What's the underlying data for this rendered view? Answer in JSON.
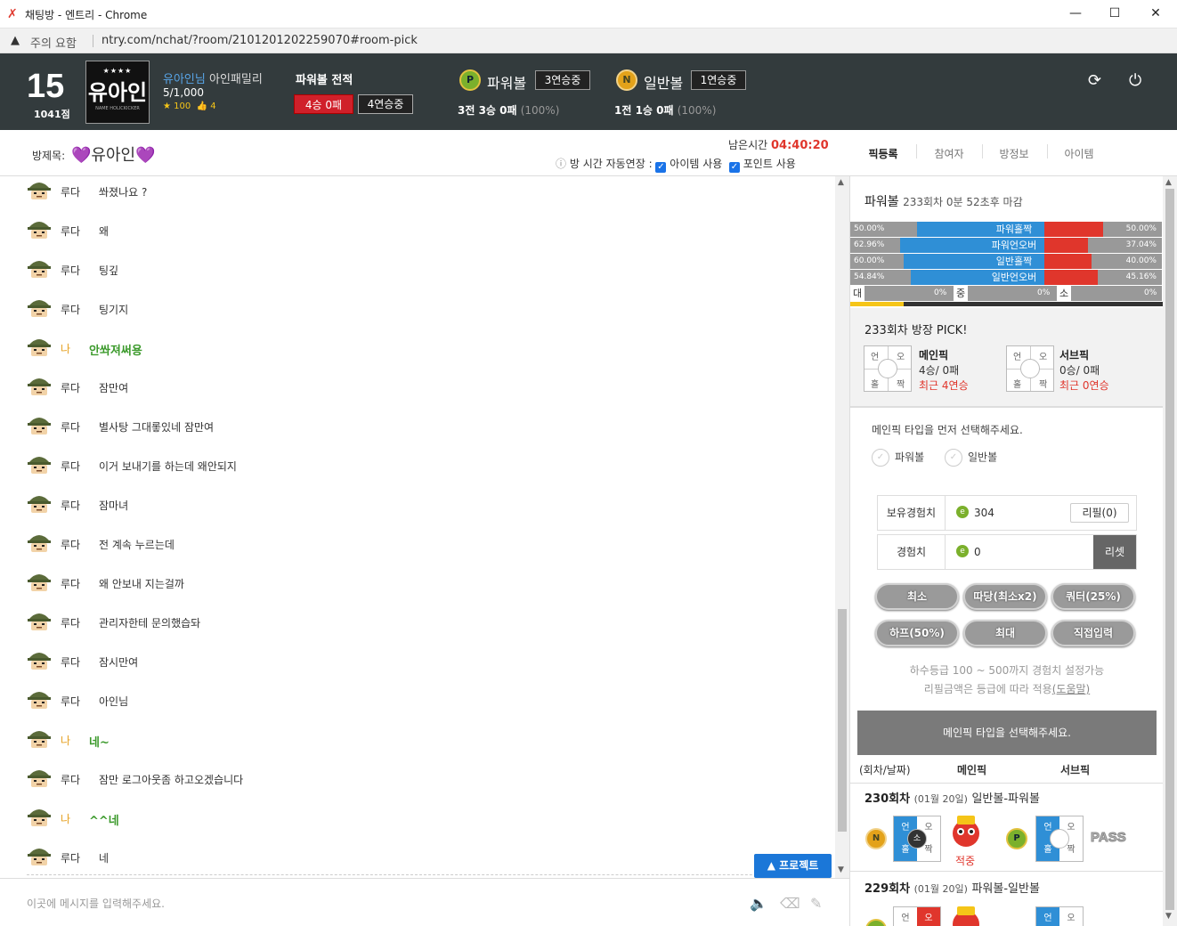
{
  "window": {
    "title": "채팅방 - 엔트리 - Chrome",
    "minimize": "—",
    "maximize": "☐",
    "close": "✕"
  },
  "address": {
    "warning": "주의 요함",
    "url": "ntry.com/nchat/?room/2101201202259070#room-pick"
  },
  "profile": {
    "level": "15",
    "points": "1041점",
    "avatar_stars": "★★★★",
    "avatar_name": "유아인",
    "avatar_sub": "NAME HOLICKICKER",
    "username": "유아인님",
    "family": "아인패밀리",
    "count": "5/1,000",
    "star_count": "100",
    "like_count": "4"
  },
  "record": {
    "title": "파워볼 전적",
    "winloss": "4승 0패",
    "streak": "4연승중"
  },
  "powerball": {
    "icon": "P",
    "label": "파워볼",
    "streak": "3연승중",
    "stat": "3전 3승 0패",
    "pct": "(100%)"
  },
  "normalball": {
    "icon": "N",
    "label": "일반볼",
    "streak": "1연승중",
    "stat": "1전 1승 0패",
    "pct": "(100%)"
  },
  "room": {
    "label": "방제목:",
    "name": "유아인",
    "remain_label": "남은시간",
    "remain_time": "04:40:20",
    "auto_extend": "방 시간 자동연장 :",
    "opt_item": "아이템 사용",
    "opt_point": "포인트 사용"
  },
  "tabs": [
    "픽등록",
    "참여자",
    "방정보",
    "아이템"
  ],
  "messages": [
    {
      "name": "루다",
      "text": "쏴졌나요 ?",
      "me": false
    },
    {
      "name": "루다",
      "text": "왜",
      "me": false
    },
    {
      "name": "루다",
      "text": "팅깊",
      "me": false
    },
    {
      "name": "루다",
      "text": "팅기지",
      "me": false
    },
    {
      "name": "나",
      "text": "안쏴져써용",
      "me": true
    },
    {
      "name": "루다",
      "text": "잠만여",
      "me": false
    },
    {
      "name": "루다",
      "text": "별사탕 그대롷있네 잠만여",
      "me": false
    },
    {
      "name": "루다",
      "text": "이거 보내기를 하는데 왜안되지",
      "me": false
    },
    {
      "name": "루다",
      "text": "잠마녀",
      "me": false
    },
    {
      "name": "루다",
      "text": "전 계속 누르는데",
      "me": false
    },
    {
      "name": "루다",
      "text": "왜 안보내 지는걸까",
      "me": false
    },
    {
      "name": "루다",
      "text": "관리자한테 문의했습돠",
      "me": false
    },
    {
      "name": "루다",
      "text": "잠시만여",
      "me": false
    },
    {
      "name": "루다",
      "text": "아인님",
      "me": false
    },
    {
      "name": "나",
      "text": "네~",
      "me": true
    },
    {
      "name": "루다",
      "text": "잠만 로그아웃좀 하고오겠습니다",
      "me": false
    },
    {
      "name": "나",
      "text": "^^네",
      "me": true
    },
    {
      "name": "루다",
      "text": "네",
      "me": false
    }
  ],
  "protect_button": "▲ 프로젝트",
  "input_placeholder": "이곳에 메시지를 입력해주세요.",
  "round": {
    "game": "파워볼",
    "info": "233회차 0분 52초후 마감"
  },
  "stats": [
    {
      "left": "50.00%",
      "label": "파워홀짝",
      "right": "50.00%",
      "lv": 0.5,
      "rv": 0.5
    },
    {
      "left": "62.96%",
      "label": "파워언오버",
      "right": "37.04%",
      "lv": 0.6296,
      "rv": 0.3704
    },
    {
      "left": "60.00%",
      "label": "일반홀짝",
      "right": "40.00%",
      "lv": 0.6,
      "rv": 0.4
    },
    {
      "left": "54.84%",
      "label": "일반언오버",
      "right": "45.16%",
      "lv": 0.5484,
      "rv": 0.4516
    }
  ],
  "size_row": {
    "big": "대",
    "big_pct": "0%",
    "mid": "중",
    "mid_pct": "0%",
    "small": "소",
    "small_pct": "0%"
  },
  "pick": {
    "title": "233회차 방장 PICK!",
    "main_title": "메인픽",
    "main_record": "4승/ 0패",
    "main_recent": "최근 4연승",
    "sub_title": "서브픽",
    "sub_record": "0승/ 0패",
    "sub_recent": "최근 0연승",
    "q_un": "언",
    "q_o": "오",
    "q_hol": "홀",
    "q_jjak": "짝"
  },
  "select": {
    "msg": "메인픽 타입을 먼저 선택해주세요.",
    "opt1": "파워볼",
    "opt2": "일반볼"
  },
  "exp": {
    "have_label": "보유경험치",
    "have_value": "304",
    "refill": "리필(0)",
    "exp_label": "경험치",
    "exp_value": "0",
    "reset": "리셋",
    "coin": "e"
  },
  "pills": [
    "최소",
    "따당(최소x2)",
    "쿼터(25%)",
    "하프(50%)",
    "최대",
    "직접입력"
  ],
  "notes": {
    "line1": "하수등급 100 ~ 500까지 경험치 설정가능",
    "line2": "리필금액은 등급에 따라 적용",
    "help": "(도움말)"
  },
  "select_button": "메인픽 타입을 선택해주세요.",
  "history_head": {
    "round": "(회차/날짜)",
    "main": "메인픽",
    "sub": "서브픽"
  },
  "history": [
    {
      "round": "230회차",
      "date": "(01월 20일)",
      "type": "일반볼-파워볼",
      "main_ball": "N",
      "main_center": "소",
      "result": "적중",
      "sub_ball": "P",
      "pass": "PASS"
    },
    {
      "round": "229회차",
      "date": "(01월 20일)",
      "type": "파워볼-일반볼"
    }
  ]
}
